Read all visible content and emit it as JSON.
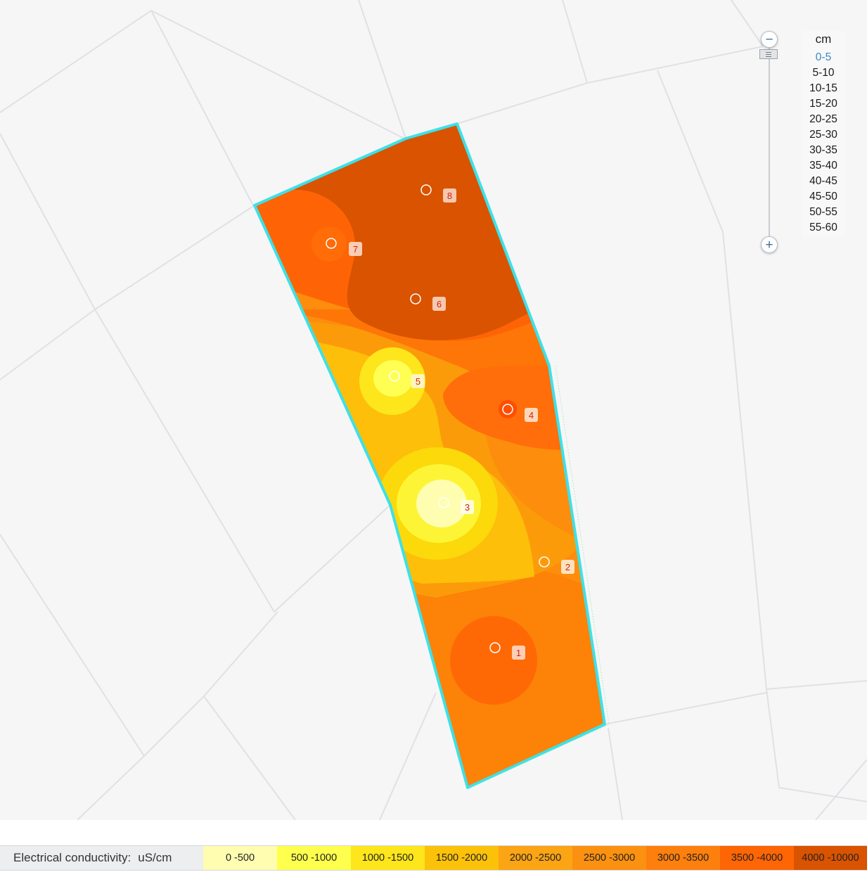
{
  "depth_selector": {
    "unit": "cm",
    "selected": "0-5",
    "options": [
      "0-5",
      "5-10",
      "10-15",
      "15-20",
      "20-25",
      "25-30",
      "30-35",
      "35-40",
      "40-45",
      "45-50",
      "50-55",
      "55-60"
    ],
    "zoom_in_symbol": "+",
    "zoom_out_symbol": "−"
  },
  "legend": {
    "title": "Electrical conductivity:",
    "unit": "uS/cm",
    "classes": [
      {
        "label": "0 -500",
        "color": "#fffdb0"
      },
      {
        "label": "500 -1000",
        "color": "#ffff4d"
      },
      {
        "label": "1000 -1500",
        "color": "#fde61b"
      },
      {
        "label": "1500 -2000",
        "color": "#fcc20a"
      },
      {
        "label": "2000 -2500",
        "color": "#fba414"
      },
      {
        "label": "2500 -3000",
        "color": "#fb9110"
      },
      {
        "label": "3000 -3500",
        "color": "#fd7f0d"
      },
      {
        "label": "3500 -4000",
        "color": "#fe6505"
      },
      {
        "label": "4000 -10000",
        "color": "#d95300"
      }
    ]
  },
  "field": {
    "boundary_color": "#3de1e8",
    "sample_points": [
      "1",
      "2",
      "3",
      "4",
      "5",
      "6",
      "7",
      "8"
    ]
  },
  "icons": {
    "zoom_in": "plus-icon",
    "zoom_out": "minus-icon",
    "slider_handle": "grip-icon",
    "sample_point": "circle-marker-icon"
  }
}
